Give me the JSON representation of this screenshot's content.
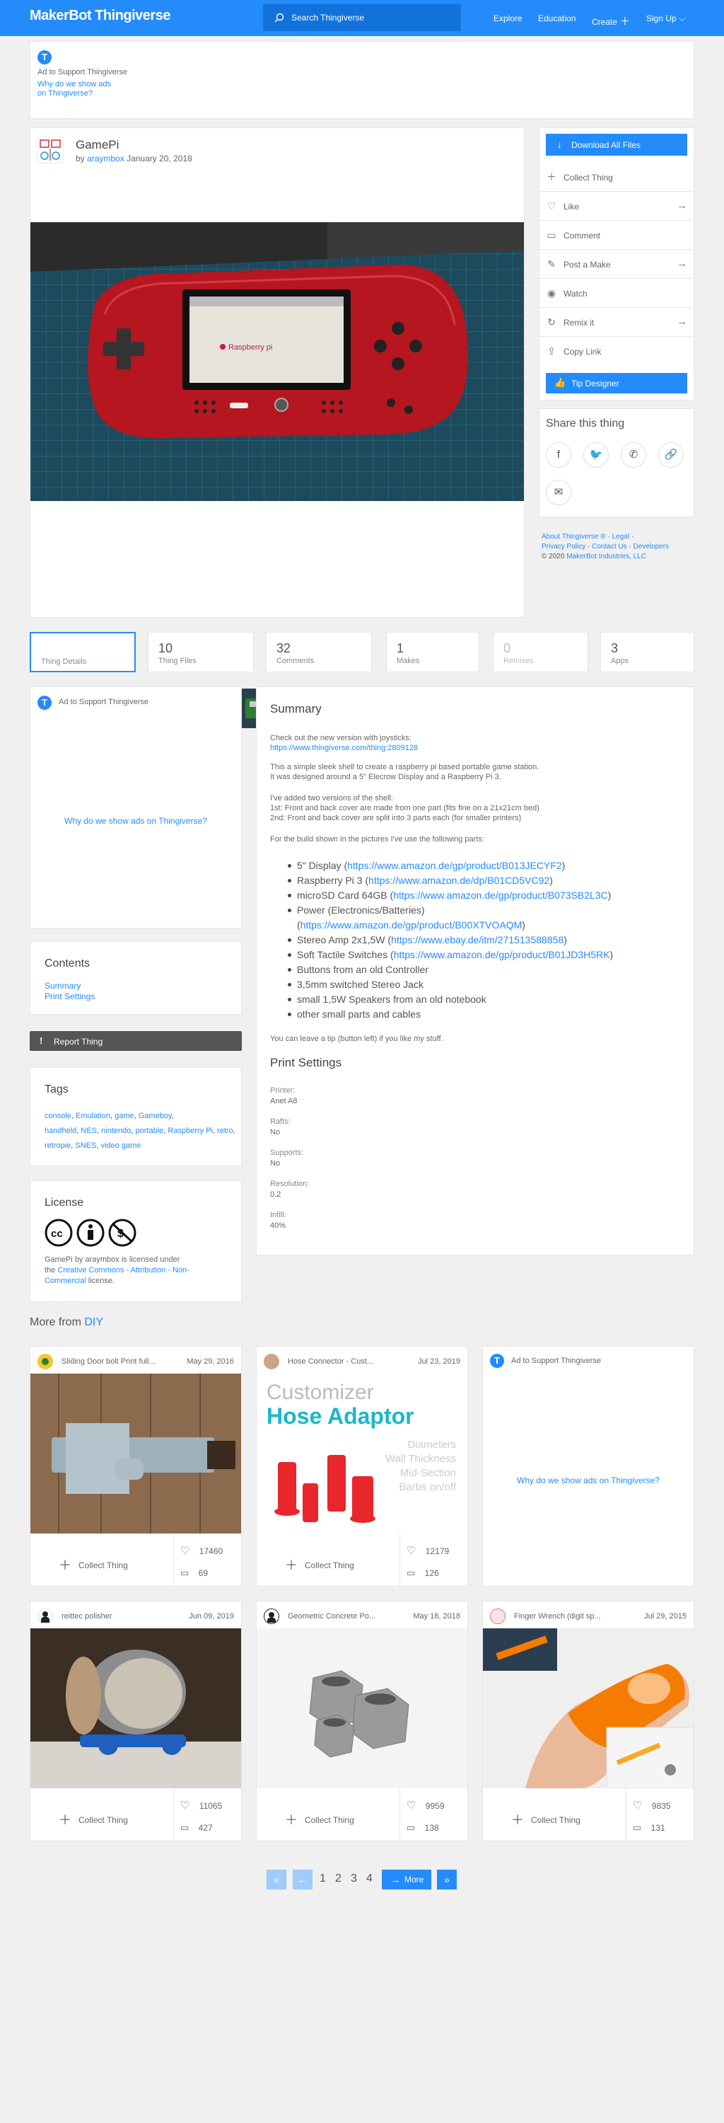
{
  "header": {
    "logo_a": "MakerBot",
    "logo_b": "Thingiverse",
    "search_placeholder": "Search Thingiverse",
    "nav": {
      "explore": "Explore",
      "education": "Education",
      "create": "Create",
      "signup": "Sign Up"
    }
  },
  "ad_top": {
    "title": "Ad to Support Thingiverse",
    "why1": "Why do we show ads",
    "why2": "on Thingiverse?"
  },
  "thing": {
    "title": "GamePi",
    "by": "by",
    "author": "araymbox",
    "date": "January 20, 2018",
    "photo_text": "Raspberry pi"
  },
  "actions": {
    "download": "Download All Files",
    "collect": "Collect Thing",
    "like": "Like",
    "comment": "Comment",
    "post_make": "Post a Make",
    "watch": "Watch",
    "remix": "Remix it",
    "copy_link": "Copy Link",
    "tip": "Tip Designer"
  },
  "share": {
    "title": "Share this thing"
  },
  "footer_links": {
    "about": "About Thingiverse ®",
    "legal": "Legal",
    "privacy": "Privacy Policy",
    "contact": "Contact Us",
    "developers": "Developers",
    "copyright": "© 2020",
    "mbi": "MakerBot Industries, LLC"
  },
  "tabs": [
    {
      "num": "",
      "label": "Thing Details"
    },
    {
      "num": "10",
      "label": "Thing Files"
    },
    {
      "num": "32",
      "label": "Comments"
    },
    {
      "num": "1",
      "label": "Makes"
    },
    {
      "num": "0",
      "label": "Remixes"
    },
    {
      "num": "3",
      "label": "Apps"
    }
  ],
  "ad_side": {
    "title": "Ad to Support Thingiverse",
    "why": "Why do we show ads on Thingiverse?"
  },
  "contents": {
    "title": "Contents",
    "summary": "Summary",
    "print": "Print Settings"
  },
  "report": "Report Thing",
  "tags": {
    "title": "Tags",
    "items": [
      "console",
      "Emulation",
      "game",
      "Gameboy",
      "handheld",
      "NES",
      "nintendo",
      "portable",
      "Raspberry Pi",
      "retro",
      "retropie",
      "SNES",
      "video game"
    ]
  },
  "license": {
    "title": "License",
    "line1a": "GamePi",
    "line1b": "by",
    "line1c": "araymbox",
    "line1d": "is licensed under",
    "line2a": "the",
    "line2b": "Creative Commons - Attribution - Non-",
    "line3a": "Commercial",
    "line3b": "license."
  },
  "summary": {
    "title": "Summary",
    "p1": "Check out the new version with joysticks:",
    "p1link": "https://www.thingiverse.com/thing:2809128",
    "p2a": "This a simple sleek shell to create a raspberry pi based portable game station.",
    "p2b": "It was designed around a 5\" Elecrow Display and a Raspberry Pi 3.",
    "p3a": "I've added two versions of the shell:",
    "p3b": "1st: Front and back cover are made from one part (fits fine on a 21x21cm bed)",
    "p3c": "2nd: Front and back cover are split into 3 parts each (for smaller printers)",
    "p4": "For the build shown in the pictures I've use the following parts:",
    "bullets": [
      {
        "text": "5\" Display (",
        "link": "https://www.amazon.de/gp/product/B013JECYF2",
        "end": ")"
      },
      {
        "text": "Raspberry Pi 3 (",
        "link": "https://www.amazon.de/dp/B01CD5VC92",
        "end": ")"
      },
      {
        "text": "microSD Card 64GB (",
        "link": "https://www.amazon.de/gp/product/B073SB2L3C",
        "end": ")"
      },
      {
        "text": "Power (Electronics/Batteries)",
        "link": "",
        "end": ""
      },
      {
        "text": "(",
        "link": "https://www.amazon.de/gp/product/B00XTVOAQM",
        "end": ")"
      },
      {
        "text": "Stereo Amp 2x1,5W (",
        "link": "https://www.ebay.de/itm/271513588858",
        "end": ")"
      },
      {
        "text": "Soft Tactile Switches (",
        "link": "https://www.amazon.de/gp/product/B01JD3H5RK",
        "end": ")"
      },
      {
        "text": "Buttons from an old Controller",
        "link": "",
        "end": ""
      },
      {
        "text": "3,5mm switched Stereo Jack",
        "link": "",
        "end": ""
      },
      {
        "text": "small 1,5W Speakers from an old notebook",
        "link": "",
        "end": ""
      },
      {
        "text": "other small parts and cables",
        "link": "",
        "end": ""
      }
    ],
    "tip": "You can leave a tip (button left) if you like my stuff."
  },
  "print_settings": {
    "title": "Print Settings",
    "rows": [
      {
        "k": "Printer:",
        "v": "Anet A8"
      },
      {
        "k": "Rafts:",
        "v": "No"
      },
      {
        "k": "Supports:",
        "v": "No"
      },
      {
        "k": "Resolution:",
        "v": "0.2"
      },
      {
        "k": "Infill:",
        "v": "40%"
      }
    ]
  },
  "more": {
    "title_a": "More from",
    "title_b": "DIY",
    "collect": "Collect Thing",
    "ad_title": "Ad to Support Thingiverse",
    "ad_why": "Why do we show ads on Thingiverse?",
    "cards": [
      {
        "name": "Sliding Door bolt Print full...",
        "date": "May 29, 2016",
        "likes": "17460",
        "comments": "69"
      },
      {
        "name": "Hose Connector - Cust...",
        "date": "Jul 23, 2019",
        "likes": "12179",
        "comments": "126",
        "img1": "Customizer",
        "img2": "Hose Adaptor",
        "img3": [
          "Diameters",
          "Wall Thickness",
          "Mid-Section",
          "Barbs on/off"
        ]
      },
      {
        "name": "reittec polisher",
        "date": "Jun 09, 2019",
        "likes": "11065",
        "comments": "427"
      },
      {
        "name": "Geometric Concrete Po...",
        "date": "May 18, 2018",
        "likes": "9959",
        "comments": "138"
      },
      {
        "name": "Finger Wrench (digit sp...",
        "date": "Jul 29, 2015",
        "likes": "9835",
        "comments": "131"
      }
    ]
  },
  "pager": {
    "p1": "1",
    "p2": "2",
    "p3": "3",
    "p4": "4",
    "more": "More"
  }
}
